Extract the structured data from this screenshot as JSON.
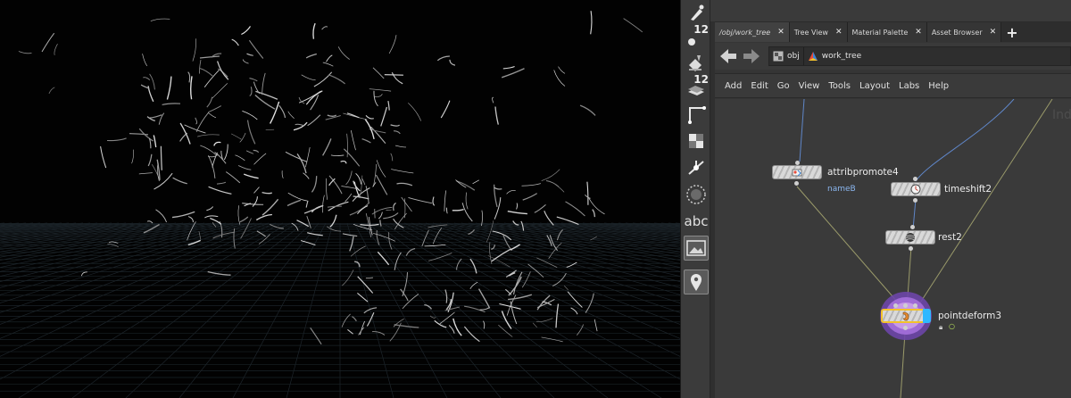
{
  "shelf": {
    "tools": [
      {
        "icon": "brush-icon"
      },
      {
        "icon": "point-count-icon",
        "badge": "12"
      },
      {
        "icon": "paint-bucket-icon"
      },
      {
        "icon": "layer-count-icon",
        "badge": "12"
      },
      {
        "icon": "curve-tool-icon"
      },
      {
        "icon": "grid-pattern-icon"
      },
      {
        "icon": "transform-handle-icon"
      },
      {
        "icon": "circle-sphere-icon"
      },
      {
        "icon": "text-tool-icon",
        "label": "abc"
      },
      {
        "icon": "image-landscape-icon"
      },
      {
        "icon": "location-pin-icon"
      }
    ]
  },
  "tabs": [
    {
      "label": "/obj/work_tree",
      "active": true
    },
    {
      "label": "Tree View"
    },
    {
      "label": "Material Palette"
    },
    {
      "label": "Asset Browser"
    }
  ],
  "path": {
    "crumbs": [
      {
        "label": "obj",
        "icon": "obj-context-icon"
      },
      {
        "label": "work_tree",
        "icon": "geometry-network-icon"
      }
    ]
  },
  "menu": [
    "Add",
    "Edit",
    "Go",
    "View",
    "Tools",
    "Layout",
    "Labs",
    "Help"
  ],
  "network": {
    "ghost_text": "Ind",
    "nodes": {
      "attribpromote": {
        "label": "attribpromote4",
        "sub": "nameB"
      },
      "timeshift": {
        "label": "timeshift2"
      },
      "rest": {
        "label": "rest2"
      },
      "pointdeform": {
        "label": "pointdeform3"
      }
    }
  },
  "colors": {
    "display_flag": "#2fb8ff",
    "render_ring": "#9f6bd6",
    "selected_outline": "#f2c22a",
    "wire": "#9a9a6a",
    "wire_blue": "#5f86c8"
  }
}
